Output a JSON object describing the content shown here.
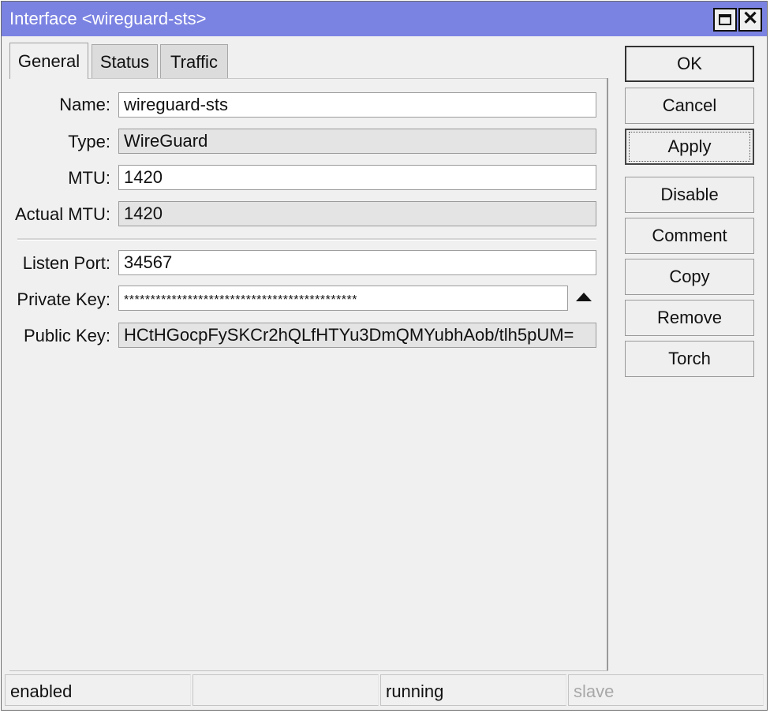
{
  "window": {
    "title": "Interface <wireguard-sts>",
    "maximize_icon": "maximize-icon",
    "close_icon": "close-icon",
    "close_glyph": "✕",
    "titlebar_color": "#7b83e2"
  },
  "tabs": [
    {
      "label": "General",
      "active": true
    },
    {
      "label": "Status",
      "active": false
    },
    {
      "label": "Traffic",
      "active": false
    }
  ],
  "fields": {
    "name": {
      "label": "Name:",
      "value": "wireguard-sts"
    },
    "type": {
      "label": "Type:",
      "value": "WireGuard"
    },
    "mtu": {
      "label": "MTU:",
      "value": "1420"
    },
    "actual_mtu": {
      "label": "Actual MTU:",
      "value": "1420"
    },
    "listen_port": {
      "label": "Listen Port:",
      "value": "34567"
    },
    "private_key": {
      "label": "Private Key:",
      "value": "********************************************"
    },
    "public_key": {
      "label": "Public Key:",
      "value": "HCtHGocpFySKCr2hQLfHTYu3DmQMYubhAob/tlh5pUM="
    }
  },
  "buttons": {
    "ok": "OK",
    "cancel": "Cancel",
    "apply": "Apply",
    "disable": "Disable",
    "comment": "Comment",
    "copy": "Copy",
    "remove": "Remove",
    "torch": "Torch"
  },
  "status": {
    "cell1": "enabled",
    "cell2": "",
    "cell3": "running",
    "cell4": "slave"
  }
}
